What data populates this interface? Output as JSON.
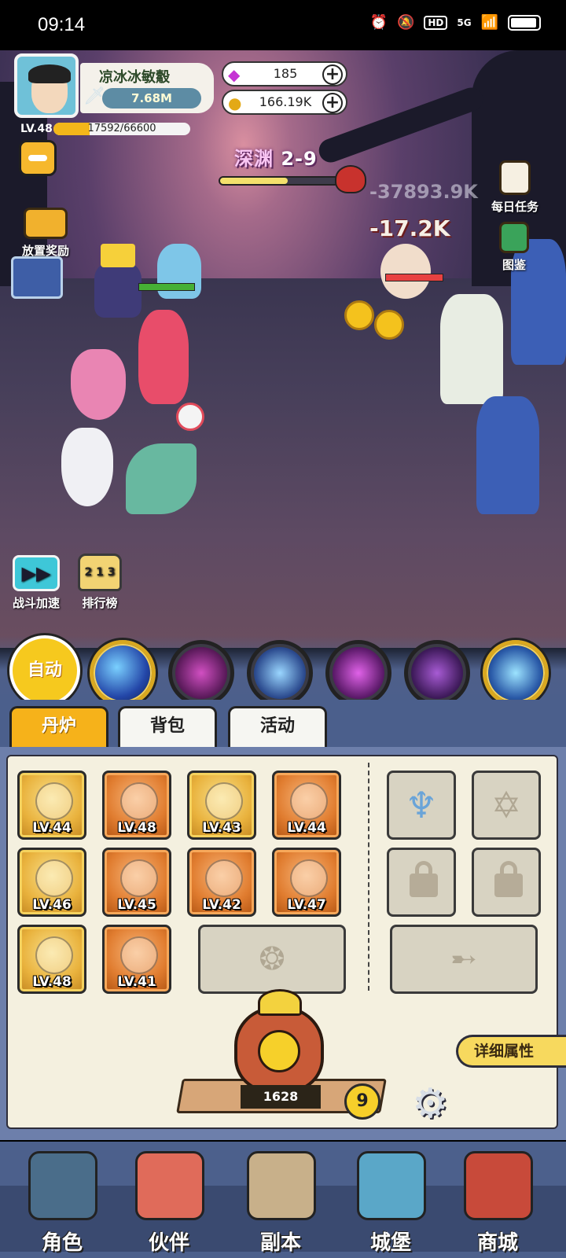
{
  "status_bar": {
    "time": "09:14",
    "hd": "HD",
    "network": "5G"
  },
  "player": {
    "name": "凉冰冰敏觳",
    "power": "7.68M",
    "level": "LV.48",
    "xp_text": "17592/66600",
    "xp_fraction": 0.264
  },
  "currencies": {
    "gems": "185",
    "gold": "166.19K"
  },
  "stage": {
    "location": "深渊",
    "number": "2-9",
    "progress_fraction": 0.55
  },
  "side_buttons": {
    "idle_reward": "放置奖励",
    "daily_task": "每日任务",
    "codex": "图鉴"
  },
  "damage": {
    "primary": "-17.2K",
    "secondary": "-37893.9K"
  },
  "action_buttons": {
    "speed_up": "战斗加速",
    "ranking": "排行榜",
    "rank_digits": "2 1 3"
  },
  "skills": {
    "auto_label": "自动"
  },
  "tabs": [
    "丹炉",
    "背包",
    "活动"
  ],
  "equipment": [
    {
      "level": "LV.44",
      "rarity": "gold",
      "icon": "sword-icon"
    },
    {
      "level": "LV.48",
      "rarity": "orange",
      "icon": "helmet-icon"
    },
    {
      "level": "LV.43",
      "rarity": "gold",
      "icon": "robe-icon"
    },
    {
      "level": "LV.44",
      "rarity": "orange",
      "icon": "orb-icon"
    },
    {
      "level": "LV.46",
      "rarity": "gold",
      "icon": "amulet-icon"
    },
    {
      "level": "LV.45",
      "rarity": "orange",
      "icon": "shield-icon"
    },
    {
      "level": "LV.42",
      "rarity": "orange",
      "icon": "ring-icon"
    },
    {
      "level": "LV.47",
      "rarity": "orange",
      "icon": "gem-icon"
    },
    {
      "level": "LV.48",
      "rarity": "gold",
      "icon": "bracelet-icon"
    },
    {
      "level": "LV.41",
      "rarity": "orange",
      "icon": "boots-icon"
    }
  ],
  "furnace": {
    "count": "1628",
    "badge": "9"
  },
  "detail_button": "详细属性",
  "nav": [
    "角色",
    "伙伴",
    "副本",
    "城堡",
    "商城"
  ],
  "colors": {
    "accent": "#f6b21a",
    "panel_bg": "#f4f0df",
    "nav_bg": "#4c608c"
  }
}
